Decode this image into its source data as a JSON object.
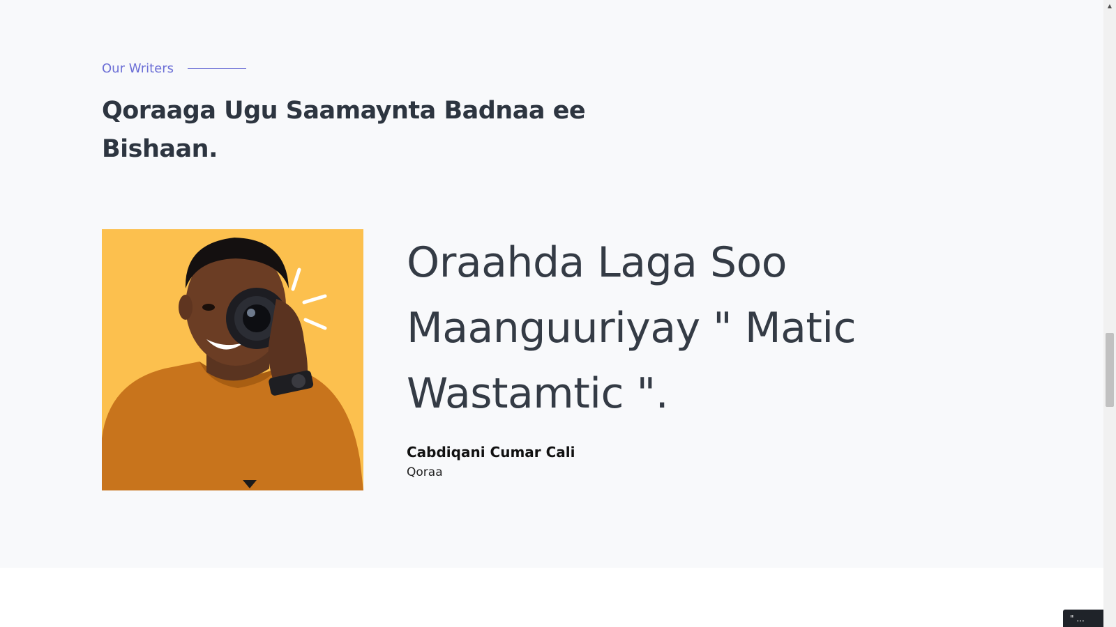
{
  "section": {
    "eyebrow": "Our Writers",
    "title": "Qoraaga Ugu Saamaynta Badnaa ee Bishaan."
  },
  "featured_writer": {
    "photo_icon": "writer-photo",
    "quote": "Oraahda Laga Soo Maanguuriyay \" Matic Wastamtic \".",
    "name": "Cabdiqani Cumar Cali",
    "role": "Qoraa"
  },
  "scrollbar": {
    "up_arrow_icon": "scroll-up-arrow-icon"
  },
  "colors": {
    "accent": "#6c6fd6",
    "heading": "#2d3540",
    "section_bg": "#f8f9fb",
    "photo_bg": "#fcc04e",
    "shirt": "#c8741c"
  },
  "corner_widget": {
    "label": "\" ..."
  }
}
